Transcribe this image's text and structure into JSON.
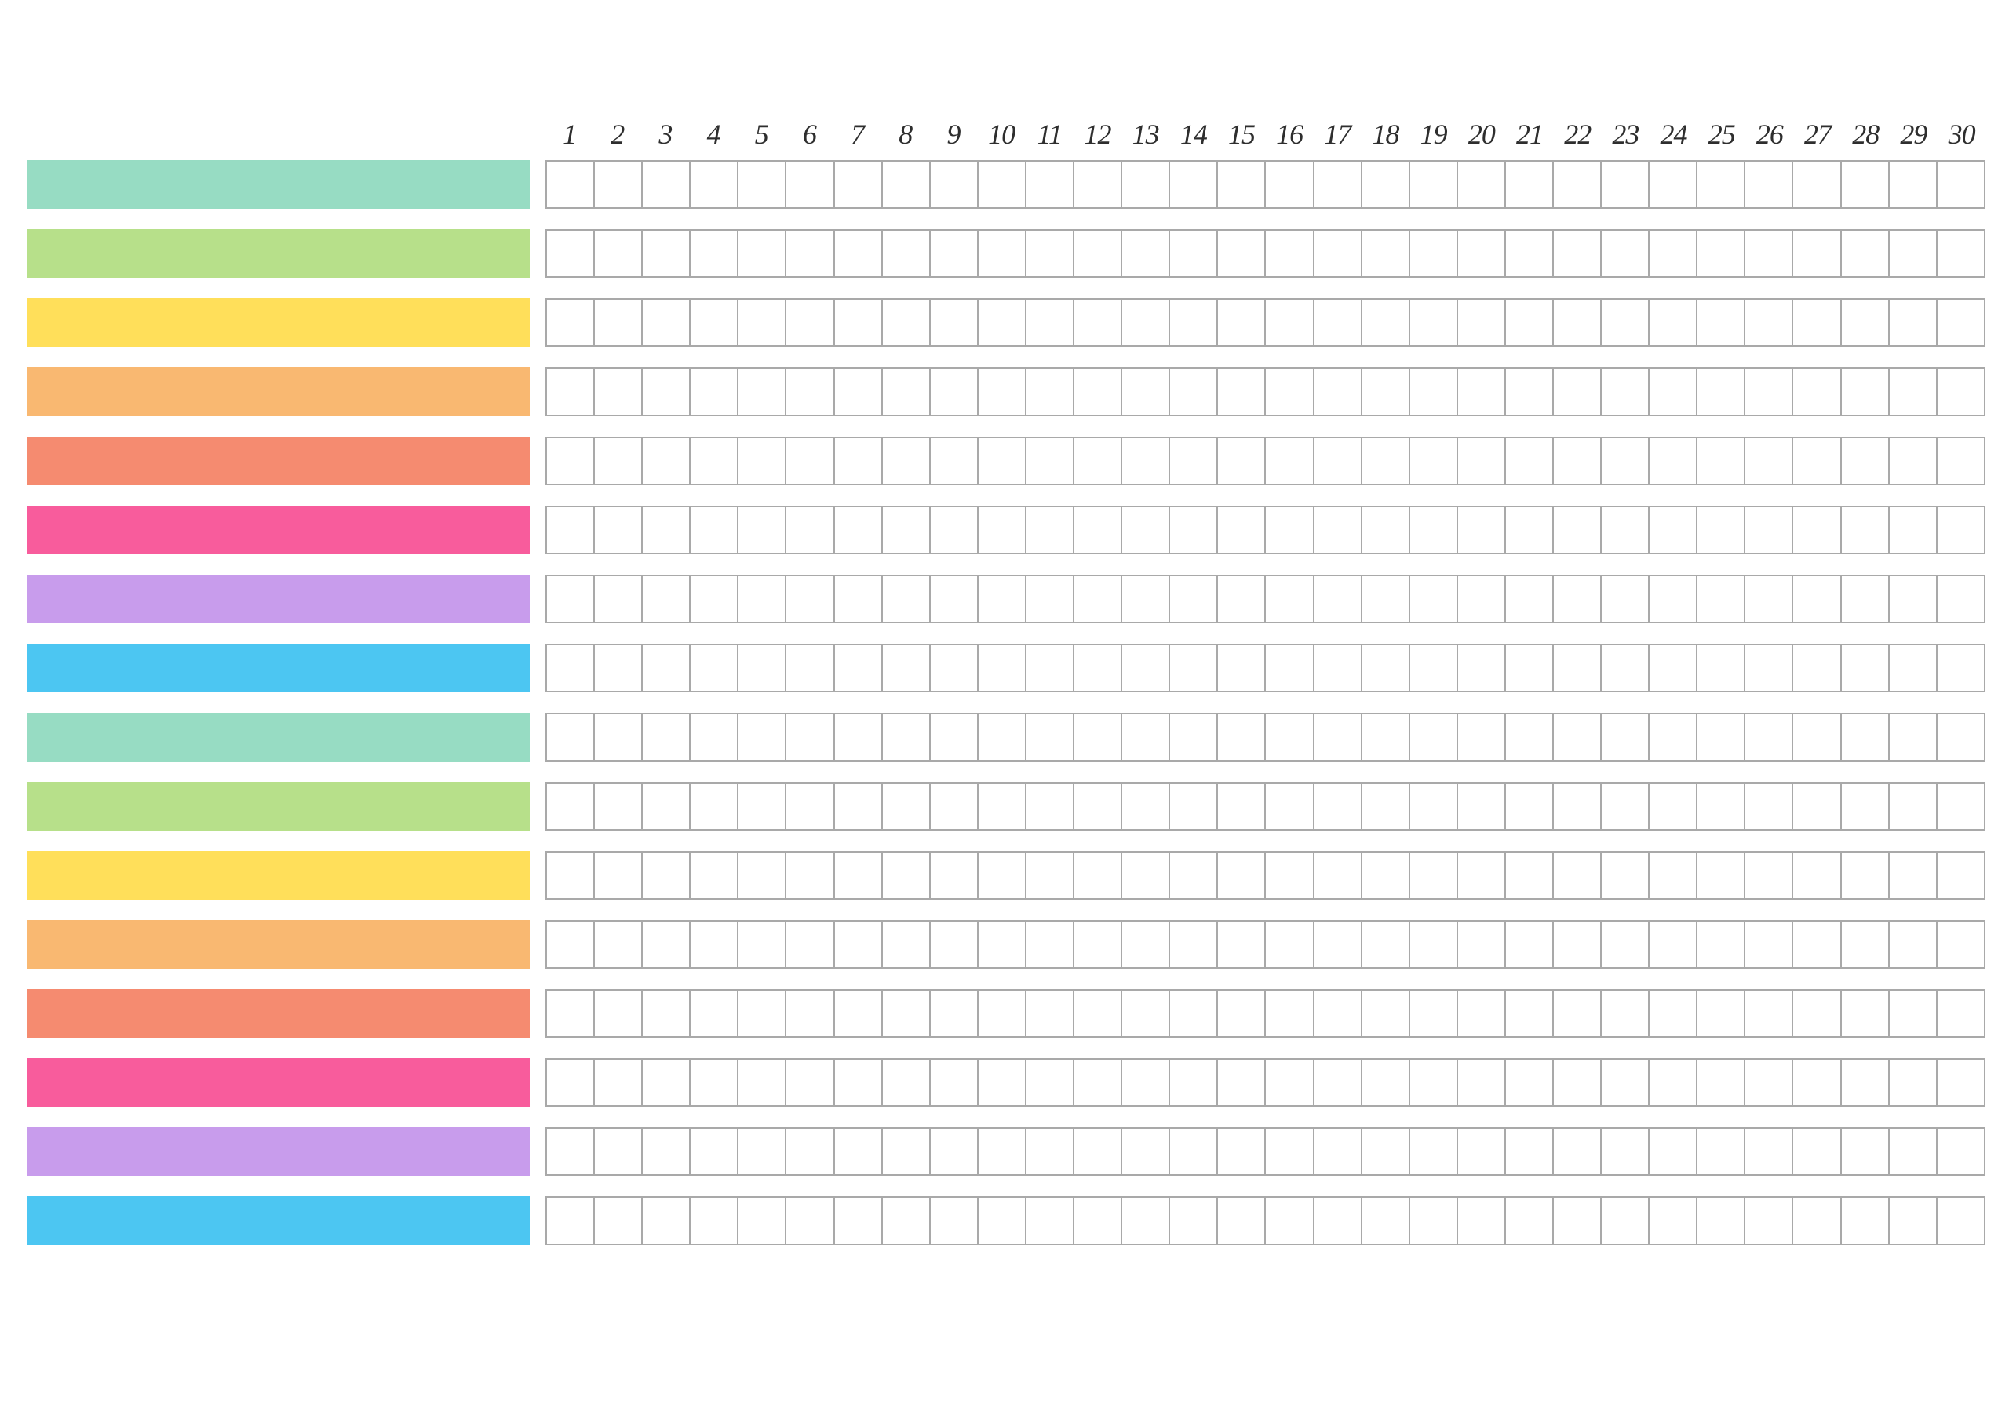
{
  "days": [
    "1",
    "2",
    "3",
    "4",
    "5",
    "6",
    "7",
    "8",
    "9",
    "10",
    "11",
    "12",
    "13",
    "14",
    "15",
    "16",
    "17",
    "18",
    "19",
    "20",
    "21",
    "22",
    "23",
    "24",
    "25",
    "26",
    "27",
    "28",
    "29",
    "30"
  ],
  "rows": [
    {
      "color": "#97dcc3"
    },
    {
      "color": "#b7e08a"
    },
    {
      "color": "#ffdf5a"
    },
    {
      "color": "#f9b871"
    },
    {
      "color": "#f58b70"
    },
    {
      "color": "#f85c9c"
    },
    {
      "color": "#c89cec"
    },
    {
      "color": "#4cc6f2"
    },
    {
      "color": "#97dcc3"
    },
    {
      "color": "#b7e08a"
    },
    {
      "color": "#ffdf5a"
    },
    {
      "color": "#f9b871"
    },
    {
      "color": "#f58b70"
    },
    {
      "color": "#f85c9c"
    },
    {
      "color": "#c89cec"
    },
    {
      "color": "#4cc6f2"
    }
  ],
  "grid_border": "#a9a9a9"
}
